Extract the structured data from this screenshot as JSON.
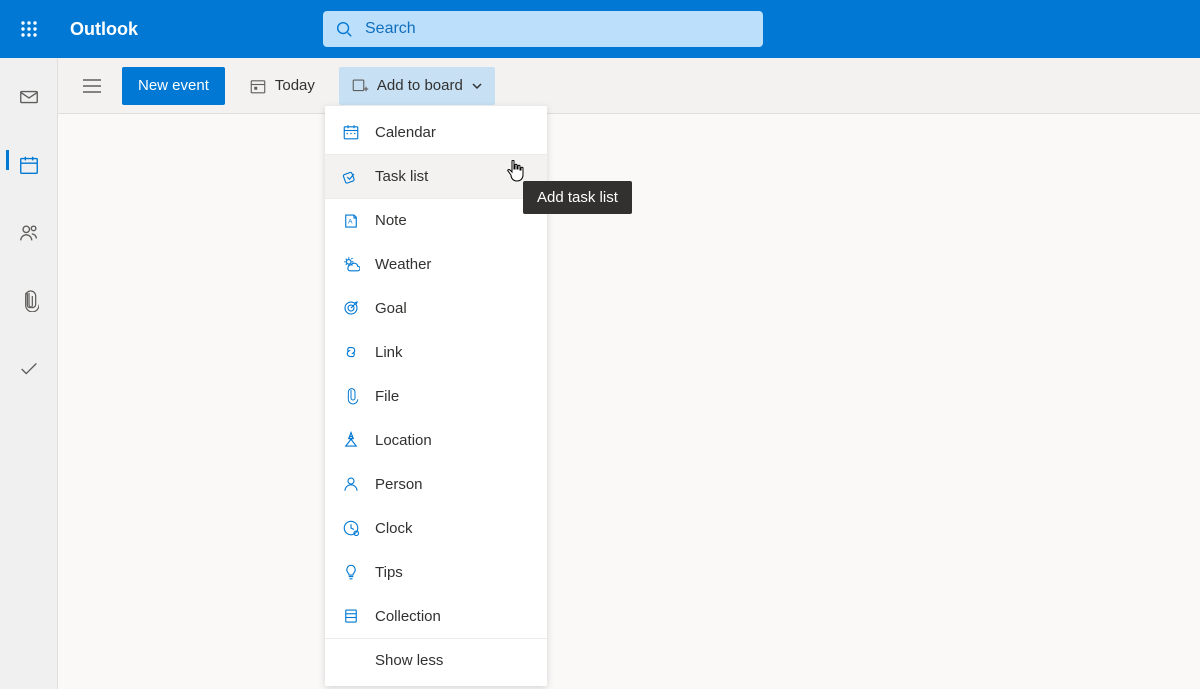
{
  "header": {
    "app_title": "Outlook",
    "search_placeholder": "Search"
  },
  "commandbar": {
    "new_event_label": "New event",
    "today_label": "Today",
    "add_to_board_label": "Add to board"
  },
  "dropdown": {
    "items": [
      {
        "label": "Calendar",
        "icon": "calendar-icon"
      },
      {
        "label": "Task list",
        "icon": "checkmark-icon"
      },
      {
        "label": "Note",
        "icon": "note-icon"
      },
      {
        "label": "Weather",
        "icon": "weather-icon"
      },
      {
        "label": "Goal",
        "icon": "target-icon"
      },
      {
        "label": "Link",
        "icon": "link-icon"
      },
      {
        "label": "File",
        "icon": "paperclip-icon"
      },
      {
        "label": "Location",
        "icon": "location-icon"
      },
      {
        "label": "Person",
        "icon": "person-icon"
      },
      {
        "label": "Clock",
        "icon": "clock-icon"
      },
      {
        "label": "Tips",
        "icon": "lightbulb-icon"
      },
      {
        "label": "Collection",
        "icon": "collection-icon"
      }
    ],
    "show_less_label": "Show less",
    "hovered_index": 1
  },
  "tooltip": {
    "text": "Add task list"
  },
  "left_rail": {
    "items": [
      {
        "icon": "mail-icon",
        "selected": false
      },
      {
        "icon": "calendar-icon",
        "selected": true
      },
      {
        "icon": "people-icon",
        "selected": false
      },
      {
        "icon": "paperclip-icon",
        "selected": false
      },
      {
        "icon": "checkmark-icon",
        "selected": false
      }
    ]
  }
}
